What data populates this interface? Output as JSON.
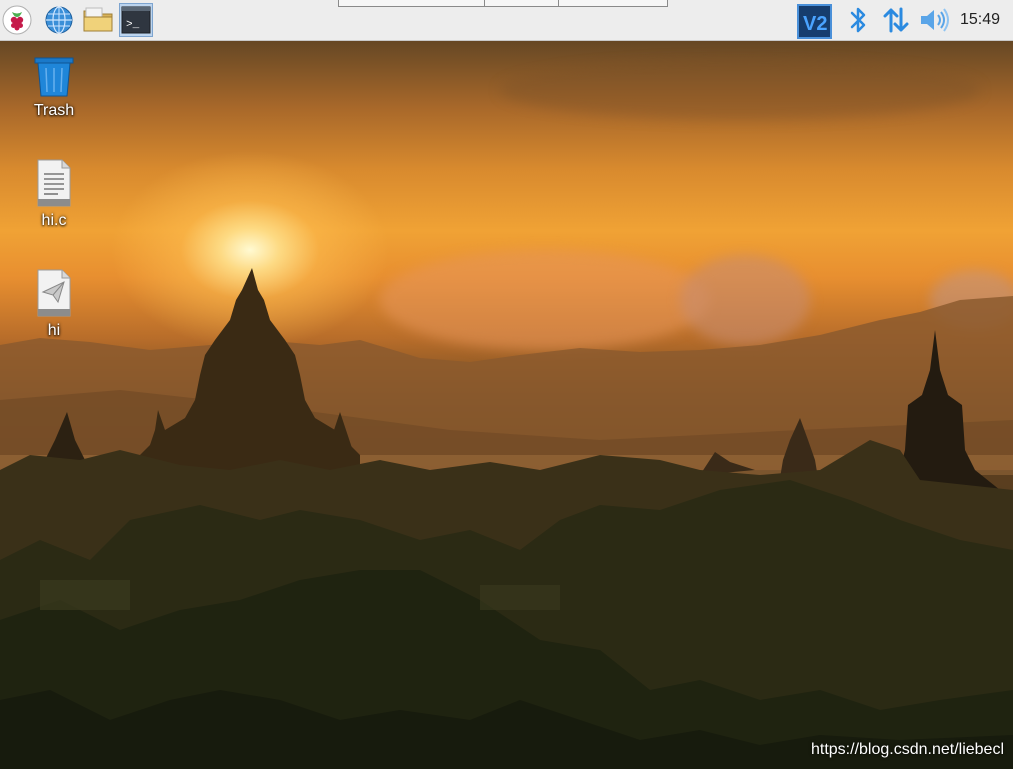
{
  "taskbar": {
    "launchers": [
      {
        "name": "raspberry-menu",
        "icon": "raspberry-icon"
      },
      {
        "name": "web-browser",
        "icon": "globe-icon"
      },
      {
        "name": "file-manager",
        "icon": "folder-icon"
      },
      {
        "name": "terminal",
        "icon": "terminal-icon"
      }
    ],
    "tray": [
      {
        "name": "vnc",
        "icon": "vnc-icon",
        "label": "V2"
      },
      {
        "name": "bluetooth",
        "icon": "bluetooth-icon"
      },
      {
        "name": "network",
        "icon": "network-arrows-icon"
      },
      {
        "name": "volume",
        "icon": "volume-icon"
      }
    ],
    "clock": "15:49",
    "terminal_prompt": ">_"
  },
  "desktop": {
    "icons": [
      {
        "label": "Trash",
        "icon": "trash-icon"
      },
      {
        "label": "hi.c",
        "icon": "text-file-icon"
      },
      {
        "label": "hi",
        "icon": "executable-file-icon"
      }
    ]
  },
  "watermark": "https://blog.csdn.net/liebecl",
  "colors": {
    "taskbar_bg": "#ededed",
    "tray_blue": "#2b8ae0",
    "trash_blue": "#1a79c9",
    "terminal_bg": "#2f3640"
  }
}
